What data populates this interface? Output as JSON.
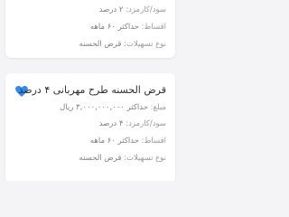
{
  "cards": [
    {
      "profit_label": "سود/کارمزد:",
      "profit_value": "۲ درصد",
      "installments_label": "اقساط:",
      "installments_value": "حداکثر ۶۰ ماهه",
      "type_label": "نوع تسهیلات:",
      "type_value": "قرض الحسنه"
    },
    {
      "title": "قرض الحسنه طرح مهربانی ۴ درصد",
      "amount_label": "مبلغ:",
      "amount_value": "حداکثر ۳,۰۰۰,۰۰۰,۰۰۰ ریال",
      "profit_label": "سود/کارمزد:",
      "profit_value": "۴ درصد",
      "installments_label": "اقساط:",
      "installments_value": "حداکثر ۶۰ ماهه",
      "type_label": "نوع تسهیلات:",
      "type_value": "قرض الحسنه",
      "favorite": true,
      "favorite_color": "#2f8af5"
    }
  ]
}
